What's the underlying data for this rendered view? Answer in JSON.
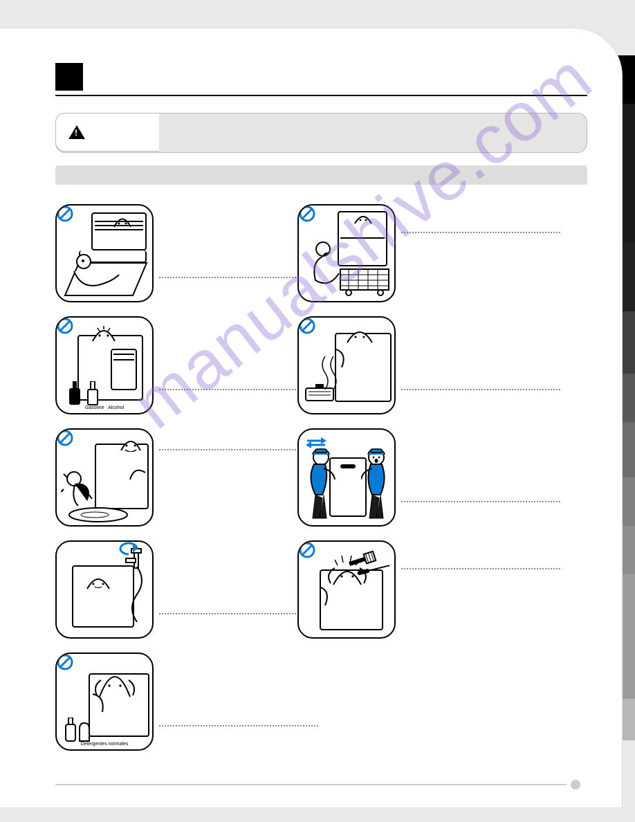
{
  "watermark_text": "manualshive.com",
  "captions": {
    "gasoline": "Gasoline",
    "alcohol": "Alcohol",
    "detergent": "Detergentes normales"
  },
  "tiles": {
    "left": [
      {
        "prohibited": true,
        "name": "child-leaning-on-door"
      },
      {
        "prohibited": true,
        "name": "gasoline-alcohol-storage"
      },
      {
        "prohibited": true,
        "name": "water-leak-child-falling"
      },
      {
        "prohibited": false,
        "name": "close-water-tap"
      },
      {
        "prohibited": true,
        "name": "normal-detergent-use"
      }
    ],
    "right": [
      {
        "prohibited": true,
        "name": "child-pulling-rack"
      },
      {
        "prohibited": true,
        "name": "heater-near-side"
      },
      {
        "prohibited": false,
        "name": "two-person-carry"
      },
      {
        "prohibited": true,
        "name": "insert-tools-top"
      }
    ]
  }
}
